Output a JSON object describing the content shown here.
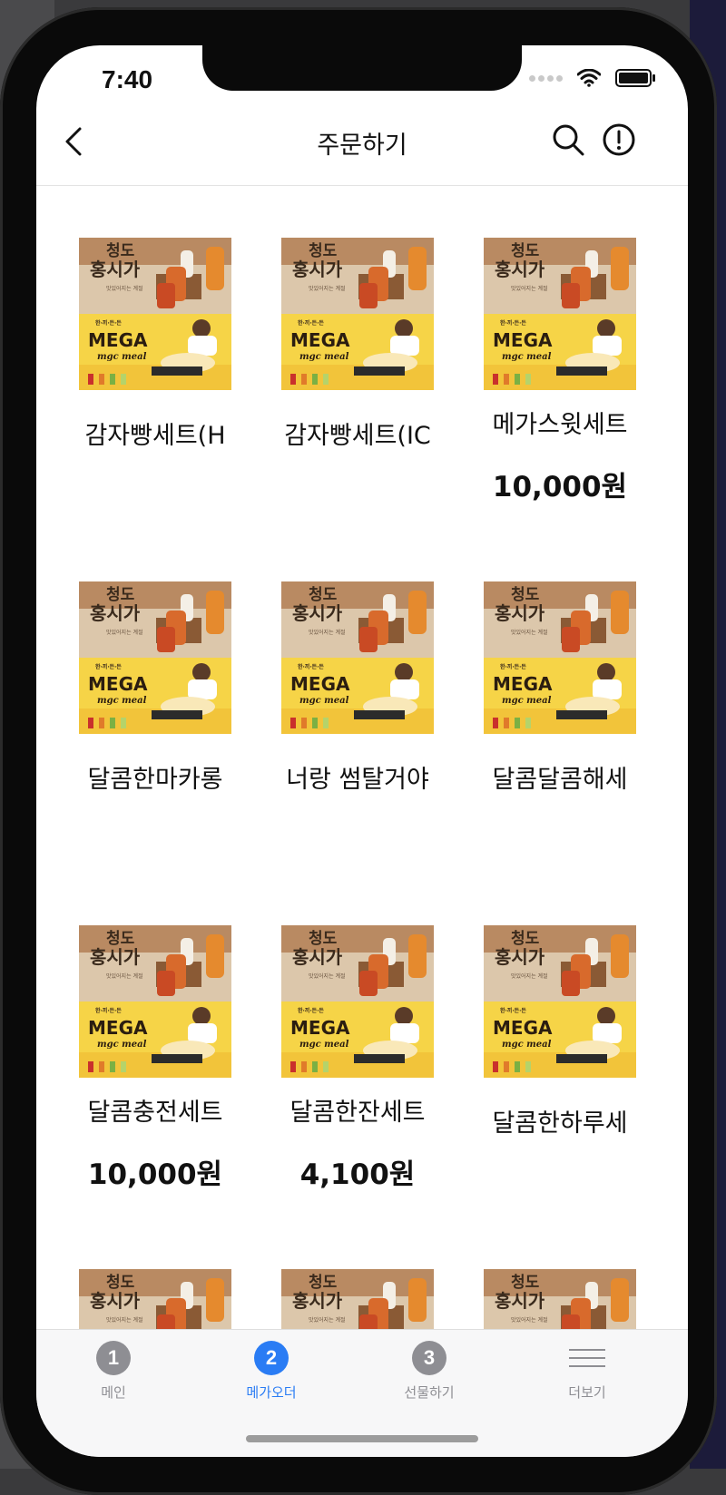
{
  "status": {
    "time": "7:40"
  },
  "header": {
    "title": "주문하기"
  },
  "banner": {
    "top_text_line1": "청도",
    "top_text_line2": "홍시가",
    "top_sub": "맛있어지는 계절",
    "brand_small": "한·끼·든·든",
    "brand_big": "MEGA",
    "brand_script": "mgc meal",
    "colors": {
      "top": "#d9c3a8",
      "bottom": "#f7d54a",
      "accent": "#e07a2a"
    }
  },
  "products": [
    {
      "name": "감자빵세트(H",
      "price": ""
    },
    {
      "name": "감자빵세트(IC",
      "price": ""
    },
    {
      "name": "메가스윗세트",
      "price": "10,000원"
    },
    {
      "name": "달콤한마카롱",
      "price": ""
    },
    {
      "name": "너랑 썸탈거야",
      "price": ""
    },
    {
      "name": "달콤달콤해세",
      "price": ""
    },
    {
      "name": "달콤충전세트",
      "price": "10,000원"
    },
    {
      "name": "달콤한잔세트",
      "price": "4,100원"
    },
    {
      "name": "달콤한하루세",
      "price": ""
    },
    {
      "name": "",
      "price": ""
    },
    {
      "name": "",
      "price": ""
    },
    {
      "name": "",
      "price": ""
    }
  ],
  "tabbar": {
    "tabs": [
      {
        "number": "1",
        "label": "메인",
        "active": false
      },
      {
        "number": "2",
        "label": "메가오더",
        "active": true
      },
      {
        "number": "3",
        "label": "선물하기",
        "active": false
      },
      {
        "label": "더보기",
        "icon": "menu-icon",
        "active": false
      }
    ],
    "active_color": "#2a7cf4",
    "inactive_color": "#8e8e93"
  }
}
